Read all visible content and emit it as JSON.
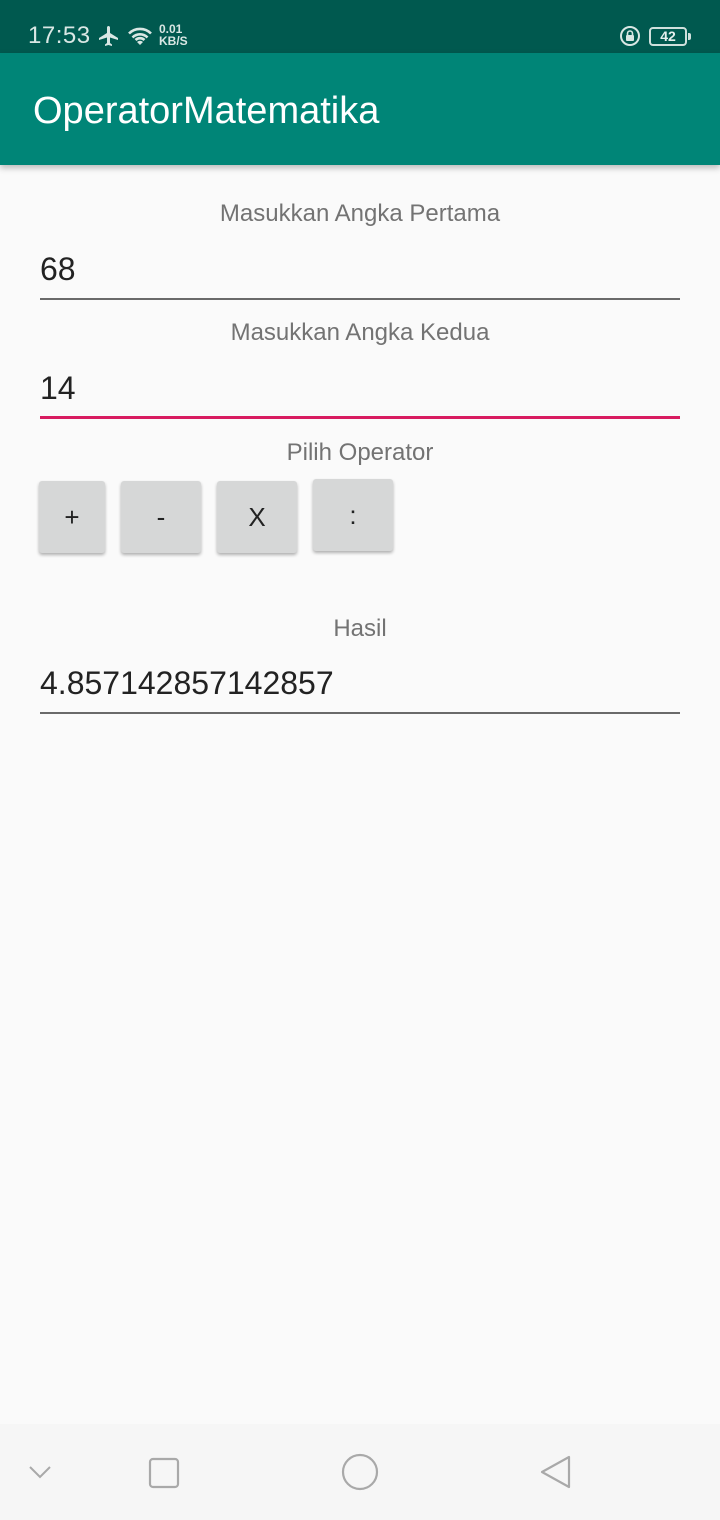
{
  "status_bar": {
    "time": "17:53",
    "net_speed_value": "0.01",
    "net_speed_unit": "KB/S",
    "battery_level": "42",
    "icons": [
      "airplane-icon",
      "wifi-icon",
      "rotation-lock-icon",
      "battery-icon"
    ]
  },
  "app_bar": {
    "title": "OperatorMatematika",
    "color": "#008577"
  },
  "form": {
    "first_label": "Masukkan Angka Pertama",
    "first_value": "68",
    "second_label": "Masukkan Angka Kedua",
    "second_value": "14",
    "operator_label": "Pilih Operator",
    "operators": [
      "+",
      "-",
      "X",
      ":"
    ],
    "result_label": "Hasil",
    "result_value": "4.857142857142857",
    "accent_color": "#d81b60"
  },
  "nav_bar": {
    "icons": [
      "chevron-down-icon",
      "recents-square-icon",
      "home-circle-icon",
      "back-triangle-icon"
    ]
  }
}
